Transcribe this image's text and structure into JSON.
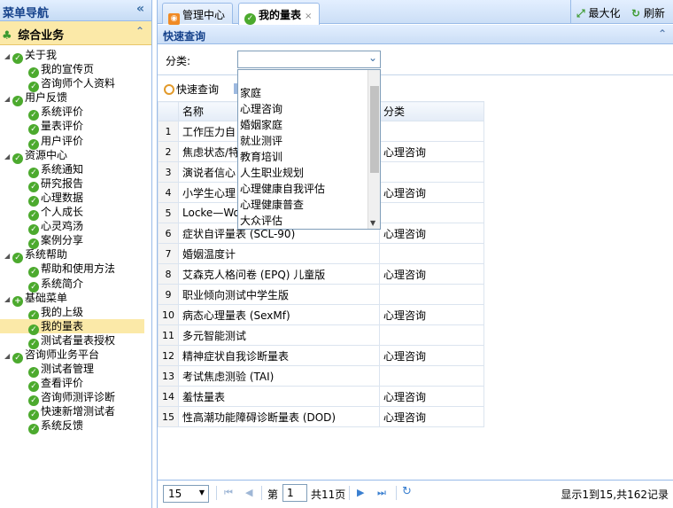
{
  "nav": {
    "title": "菜单导航",
    "collapse_glyph": "«",
    "section": "综合业务",
    "section_glyph": "⌃",
    "tree": [
      {
        "label": "关于我",
        "type": "parent"
      },
      {
        "label": "我的宣传页",
        "type": "child"
      },
      {
        "label": "咨询师个人资料",
        "type": "child"
      },
      {
        "label": "用户反馈",
        "type": "parent"
      },
      {
        "label": "系统评价",
        "type": "child"
      },
      {
        "label": "量表评价",
        "type": "child"
      },
      {
        "label": "用户评价",
        "type": "child"
      },
      {
        "label": "资源中心",
        "type": "parent"
      },
      {
        "label": "系统通知",
        "type": "child"
      },
      {
        "label": "研究报告",
        "type": "child"
      },
      {
        "label": "心理数据",
        "type": "child"
      },
      {
        "label": "个人成长",
        "type": "child"
      },
      {
        "label": "心灵鸡汤",
        "type": "child"
      },
      {
        "label": "案例分享",
        "type": "child"
      },
      {
        "label": "系统帮助",
        "type": "parent"
      },
      {
        "label": "帮助和使用方法",
        "type": "child"
      },
      {
        "label": "系统简介",
        "type": "child"
      },
      {
        "label": "基础菜单",
        "type": "parent",
        "icon": "plus"
      },
      {
        "label": "我的上级",
        "type": "child"
      },
      {
        "label": "我的量表",
        "type": "child",
        "selected": true
      },
      {
        "label": "测试者量表授权",
        "type": "child"
      },
      {
        "label": "咨询师业务平台",
        "type": "parent"
      },
      {
        "label": "测试者管理",
        "type": "child"
      },
      {
        "label": "查看评价",
        "type": "child"
      },
      {
        "label": "咨询师测评诊断",
        "type": "child"
      },
      {
        "label": "快速新增测试者",
        "type": "child"
      },
      {
        "label": "系统反馈",
        "type": "child"
      }
    ]
  },
  "tabs": [
    {
      "label": "管理中心",
      "icon": "rss-icon"
    },
    {
      "label": "我的量表",
      "icon": "check-icon",
      "close": "×"
    }
  ],
  "toolbar": {
    "maximize": "最大化",
    "refresh": "刷新"
  },
  "query": {
    "title": "快速查询",
    "category_label": "分类:",
    "category_value": "",
    "button": "快速查询"
  },
  "dropdown_options": [
    "家庭",
    "心理咨询",
    "婚姻家庭",
    "就业测评",
    "教育培训",
    "人生职业规划",
    "心理健康自我评估",
    "心理健康普查",
    "大众评估"
  ],
  "grid": {
    "columns": [
      "",
      "名称",
      "分类"
    ],
    "rows": [
      {
        "no": "1",
        "name": "工作压力自",
        "cat": ""
      },
      {
        "no": "2",
        "name": "焦虑状态/特",
        "cat": "心理咨询"
      },
      {
        "no": "3",
        "name": "演说者信心",
        "cat": ""
      },
      {
        "no": "4",
        "name": "小学生心理",
        "cat": "心理咨询"
      },
      {
        "no": "5",
        "name": "Locke—Wol",
        "cat": ""
      },
      {
        "no": "6",
        "name": "症状自评量表 (SCL-90)",
        "cat": "心理咨询"
      },
      {
        "no": "7",
        "name": "婚姻温度计",
        "cat": ""
      },
      {
        "no": "8",
        "name": "艾森克人格问卷 (EPQ) 儿童版",
        "cat": "心理咨询"
      },
      {
        "no": "9",
        "name": "职业倾向测试中学生版",
        "cat": ""
      },
      {
        "no": "10",
        "name": "病态心理量表 (SexMf)",
        "cat": "心理咨询"
      },
      {
        "no": "11",
        "name": "多元智能测试",
        "cat": ""
      },
      {
        "no": "12",
        "name": "精神症状自我诊断量表",
        "cat": "心理咨询"
      },
      {
        "no": "13",
        "name": "考试焦虑测验 (TAI)",
        "cat": ""
      },
      {
        "no": "14",
        "name": "羞怯量表",
        "cat": "心理咨询"
      },
      {
        "no": "15",
        "name": "性高潮功能障碍诊断量表 (DOD)",
        "cat": "心理咨询"
      }
    ]
  },
  "pager": {
    "page_size": "15",
    "page_prefix": "第",
    "page_value": "1",
    "page_total": "共11页",
    "summary": "显示1到15,共162记录"
  }
}
